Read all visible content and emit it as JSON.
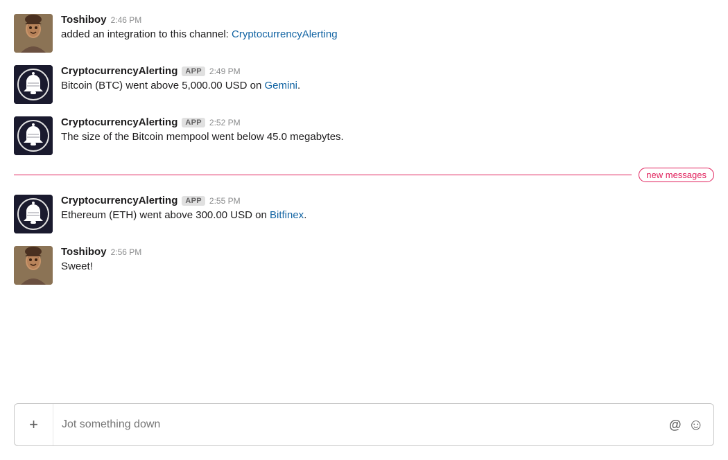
{
  "messages": [
    {
      "id": "msg1",
      "type": "human",
      "username": "Toshiboy",
      "timestamp": "2:46 PM",
      "text_before_link": "added an integration to this channel: ",
      "link_text": "CryptocurrencyAlerting",
      "link_url": "#",
      "text_after_link": "",
      "is_app": false
    },
    {
      "id": "msg2",
      "type": "bot",
      "username": "CryptocurrencyAlerting",
      "timestamp": "2:49 PM",
      "text_before_link": "Bitcoin (BTC) went above 5,000.00 USD on ",
      "link_text": "Gemini",
      "link_url": "#",
      "text_after_link": ".",
      "is_app": true
    },
    {
      "id": "msg3",
      "type": "bot",
      "username": "CryptocurrencyAlerting",
      "timestamp": "2:52 PM",
      "text_before_link": "The size of the Bitcoin mempool went below 45.0 megabytes.",
      "link_text": "",
      "link_url": "",
      "text_after_link": "",
      "is_app": true
    },
    {
      "id": "msg4",
      "type": "bot",
      "username": "CryptocurrencyAlerting",
      "timestamp": "2:55 PM",
      "text_before_link": "Ethereum (ETH) went above 300.00 USD on ",
      "link_text": "Bitfinex",
      "link_url": "#",
      "text_after_link": ".",
      "is_app": true
    },
    {
      "id": "msg5",
      "type": "human",
      "username": "Toshiboy",
      "timestamp": "2:56 PM",
      "text_before_link": "Sweet!",
      "link_text": "",
      "link_url": "",
      "text_after_link": "",
      "is_app": false
    }
  ],
  "new_messages_divider": {
    "label": "new messages",
    "after_message_id": "msg3"
  },
  "input": {
    "placeholder": "Jot something down",
    "add_label": "+",
    "mention_icon": "@",
    "emoji_icon": "☺"
  },
  "badges": {
    "app_label": "APP"
  }
}
